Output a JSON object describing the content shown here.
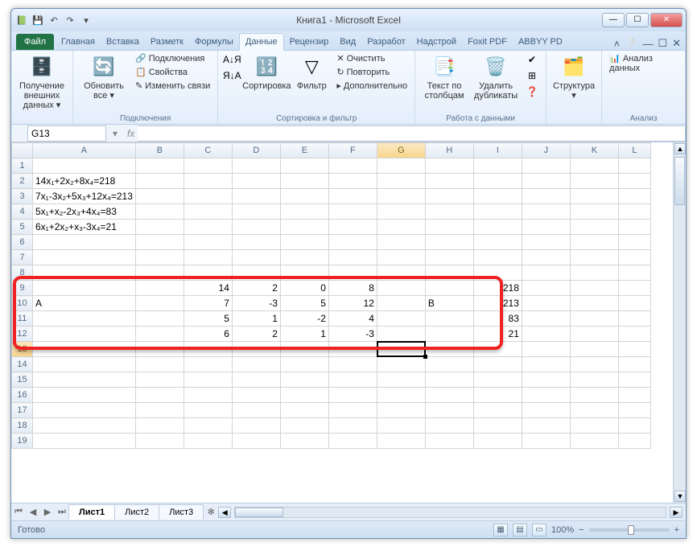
{
  "window": {
    "title": "Книга1 - Microsoft Excel",
    "min": "—",
    "max": "☐",
    "close": "✕"
  },
  "qa": {
    "save": "💾",
    "undo": "↶",
    "redo": "↷",
    "dd": "▾"
  },
  "tabs": {
    "file": "Файл",
    "items": [
      "Главная",
      "Вставка",
      "Разметк",
      "Формулы",
      "Данные",
      "Рецензир",
      "Вид",
      "Разработ",
      "Надстрой",
      "Foxit PDF",
      "ABBYY PD"
    ],
    "active": 4
  },
  "ribbon": {
    "g1": {
      "btn": "Получение внешних данных ▾",
      "label": ""
    },
    "g2": {
      "btn": "Обновить все ▾",
      "sub1": "🔗 Подключения",
      "sub2": "📋 Свойства",
      "sub3": "✎ Изменить связи",
      "label": "Подключения"
    },
    "g3": {
      "az": "А↓Я",
      "za": "Я↓А",
      "sort": "Сортировка",
      "filter": "Фильтр",
      "clr": "✕ Очистить",
      "re": "↻ Повторить",
      "adv": "▸ Дополнительно",
      "label": "Сортировка и фильтр"
    },
    "g4": {
      "b1": "Текст по столбцам",
      "b2": "Удалить дубликаты",
      "label": "Работа с данными"
    },
    "g5": {
      "btn": "Структура ▾",
      "label": ""
    },
    "g6": {
      "btn": "📊 Анализ данных",
      "label": "Анализ"
    }
  },
  "namebox": "G13",
  "columns": [
    "A",
    "B",
    "C",
    "D",
    "E",
    "F",
    "G",
    "H",
    "I",
    "J",
    "K",
    "L"
  ],
  "rowcount": 19,
  "selected": {
    "row": 13,
    "col": "G"
  },
  "equations": {
    "r2": "14x₁+2x₂+8x₄=218",
    "r3": "7x₁-3x₂+5x₃+12x₄=213",
    "r4": "5x₁+x₂-2x₃+4x₄=83",
    "r5": "6x₁+2x₂+x₃-3x₄=21"
  },
  "cells": {
    "A10": "A",
    "H10": "B",
    "C9": "14",
    "D9": "2",
    "E9": "0",
    "F9": "8",
    "I9": "218",
    "C10": "7",
    "D10": "-3",
    "E10": "5",
    "F10": "12",
    "I10": "213",
    "C11": "5",
    "D11": "1",
    "E11": "-2",
    "F11": "4",
    "I11": "83",
    "C12": "6",
    "D12": "2",
    "E12": "1",
    "F12": "-3",
    "I12": "21"
  },
  "sheets": {
    "items": [
      "Лист1",
      "Лист2",
      "Лист3"
    ],
    "active": 0
  },
  "status": {
    "ready": "Готово",
    "zoom": "100%"
  }
}
